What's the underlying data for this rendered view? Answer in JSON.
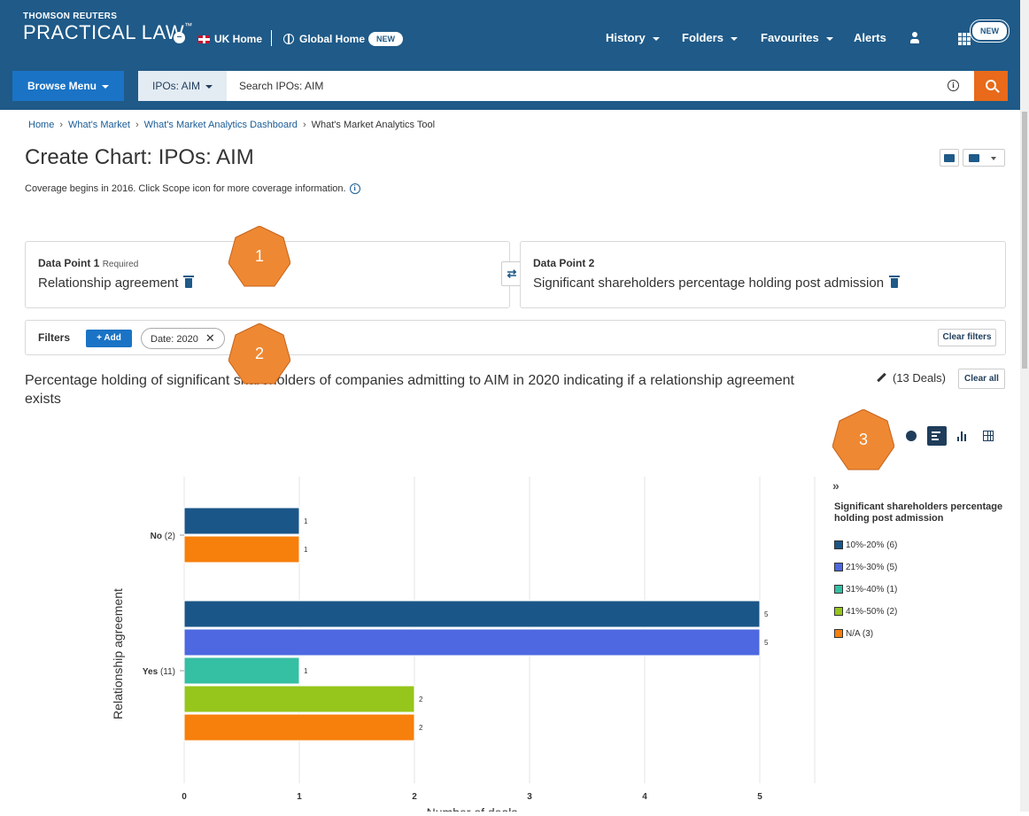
{
  "header": {
    "brand_small": "THOMSON REUTERS",
    "brand_name": "PRACTICAL LAW",
    "brand_tm": "™",
    "uk_home": "UK Home",
    "global_home": "Global Home",
    "new_pill": "NEW",
    "nav": [
      {
        "label": "History"
      },
      {
        "label": "Folders"
      },
      {
        "label": "Favourites"
      },
      {
        "label": "Alerts"
      }
    ],
    "apps_badge": "NEW"
  },
  "searchbar": {
    "browse_label": "Browse Menu",
    "scope_label": "IPOs: AIM",
    "placeholder": "Search IPOs: AIM"
  },
  "breadcrumb": [
    "Home",
    "What's Market",
    "What's Market Analytics Dashboard",
    "What's Market Analytics Tool"
  ],
  "page_title": "Create Chart: IPOs: AIM",
  "coverage_text": "Coverage begins in 2016. Click Scope icon for more coverage information.",
  "data_point_1": {
    "label": "Data Point 1",
    "required": "Required",
    "value": "Relationship agreement"
  },
  "data_point_2": {
    "label": "Data Point 2",
    "value": "Significant shareholders percentage holding post admission"
  },
  "filters": {
    "label": "Filters",
    "add_label": "+ Add",
    "chip": "Date: 2020",
    "clear_label": "Clear filters"
  },
  "chart_header": {
    "title": "Percentage holding of significant shareholders of companies admitting to AIM in 2020 indicating if a relationship agreement exists",
    "deals": "(13 Deals)",
    "clear_all": "Clear all"
  },
  "annotations": [
    "1",
    "2",
    "3"
  ],
  "colors": {
    "accent": "#1a73c5",
    "header": "#1f5a88",
    "search": "#e86a1a",
    "annotation": "#ee8833"
  },
  "legend": {
    "title": "Significant shareholders percentage holding post admission",
    "items": [
      {
        "label": "10%-20% (6)",
        "color": "#1b5688"
      },
      {
        "label": "21%-30% (5)",
        "color": "#4d68e0"
      },
      {
        "label": "31%-40% (1)",
        "color": "#35bfa3"
      },
      {
        "label": "41%-50% (2)",
        "color": "#96c51c"
      },
      {
        "label": "N/A (3)",
        "color": "#f77f0b"
      }
    ]
  },
  "chart_data": {
    "type": "bar",
    "orientation": "horizontal",
    "xlabel": "Number of deals",
    "ylabel": "Relationship agreement",
    "xlim": [
      0,
      5
    ],
    "xticks": [
      0,
      1,
      2,
      3,
      4,
      5
    ],
    "categories": [
      {
        "name": "No",
        "count": "(2)",
        "bars": [
          {
            "series": "10%-20%",
            "value": 1,
            "color": "#1b5688"
          },
          {
            "series": "N/A",
            "value": 1,
            "color": "#f77f0b"
          }
        ]
      },
      {
        "name": "Yes",
        "count": "(11)",
        "bars": [
          {
            "series": "10%-20%",
            "value": 5,
            "color": "#1b5688"
          },
          {
            "series": "21%-30%",
            "value": 5,
            "color": "#4d68e0"
          },
          {
            "series": "31%-40%",
            "value": 1,
            "color": "#35bfa3"
          },
          {
            "series": "41%-50%",
            "value": 2,
            "color": "#96c51c"
          },
          {
            "series": "N/A",
            "value": 2,
            "color": "#f77f0b"
          }
        ]
      }
    ],
    "grid": true
  }
}
